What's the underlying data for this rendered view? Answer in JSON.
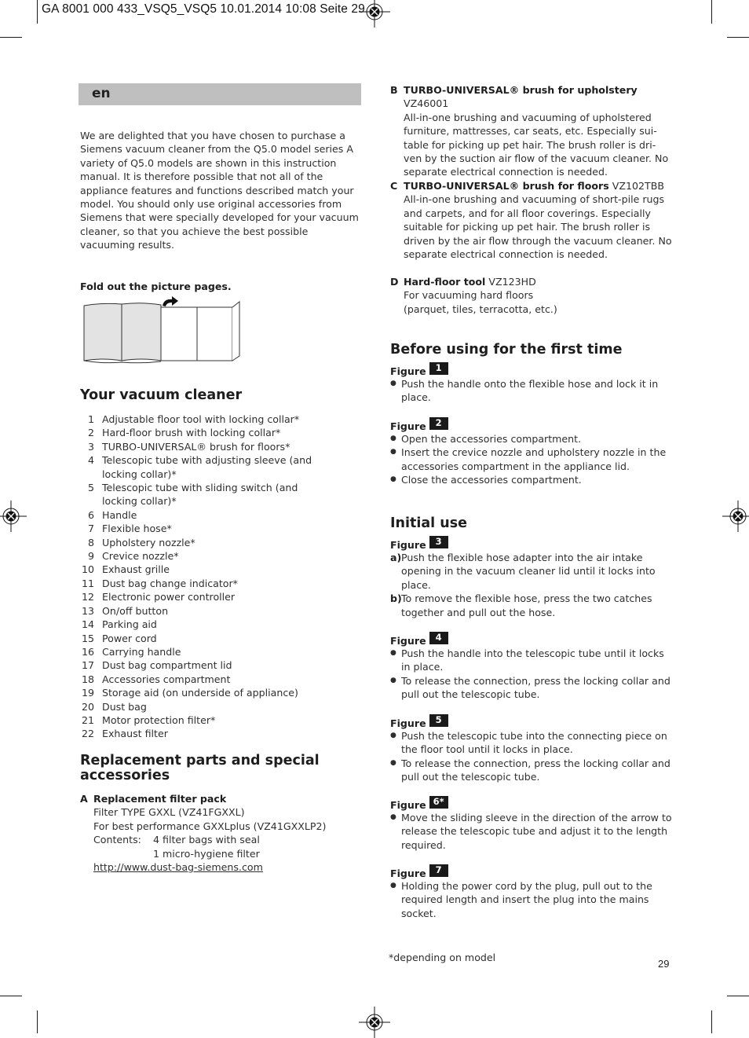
{
  "slug": "GA 8001 000 433_VSQ5_VSQ5  10.01.2014  10:08  Seite 29",
  "language_tab": "en",
  "intro": "We are delighted that you have chosen to purchase a Siemens vacuum cleaner from the Q5.0 model series A variety of Q5.0 models are shown in this instruction manual. It is therefore possible that not all of the appliance features and functions described match your model. You should only use original accessories from Siemens that were specially developed for your vacuum cleaner, so that you achieve the best possible vacuuming results.",
  "fold_out": "Fold out the picture pages.",
  "your_vacuum": {
    "heading": "Your vacuum cleaner",
    "parts": [
      {
        "n": "1",
        "t": "Adjustable floor tool with locking collar*"
      },
      {
        "n": "2",
        "t": "Hard-floor brush with locking collar*"
      },
      {
        "n": "3",
        "t": "TURBO-UNIVERSAL® brush for floors*"
      },
      {
        "n": "4",
        "t": "Telescopic tube with adjusting sleeve (and locking collar)*"
      },
      {
        "n": "5",
        "t": "Telescopic tube with sliding switch (and locking collar)*"
      },
      {
        "n": "6",
        "t": "Handle"
      },
      {
        "n": "7",
        "t": "Flexible hose*"
      },
      {
        "n": "8",
        "t": "Upholstery nozzle*"
      },
      {
        "n": "9",
        "t": "Crevice nozzle*"
      },
      {
        "n": "10",
        "t": "Exhaust grille"
      },
      {
        "n": "11",
        "t": "Dust bag change indicator*"
      },
      {
        "n": "12",
        "t": "Electronic power controller"
      },
      {
        "n": "13",
        "t": "On/off button"
      },
      {
        "n": "14",
        "t": "Parking aid"
      },
      {
        "n": "15",
        "t": "Power cord"
      },
      {
        "n": "16",
        "t": "Carrying handle"
      },
      {
        "n": "17",
        "t": "Dust bag compartment lid"
      },
      {
        "n": "18",
        "t": "Accessories compartment"
      },
      {
        "n": "19",
        "t": "Storage aid (on underside of appliance)"
      },
      {
        "n": "20",
        "t": "Dust bag"
      },
      {
        "n": "21",
        "t": "Motor protection filter*"
      },
      {
        "n": "22",
        "t": "Exhaust filter"
      }
    ]
  },
  "replacement": {
    "heading": "Replacement parts and special accessories",
    "A": {
      "letter": "A",
      "title": "Replacement filter pack",
      "line1": "Filter TYPE GXXL (VZ41FGXXL)",
      "line2": "For best performance GXXLplus (VZ41GXXLP2)",
      "contents_label": "Contents:",
      "contents_1": "4 filter bags with seal",
      "contents_2": "1 micro-hygiene filter",
      "url": "http://www.dust-bag-siemens.com"
    },
    "B": {
      "letter": "B",
      "title": "TURBO-UNIVERSAL® brush for upholstery",
      "code": "VZ46001",
      "body": "All-in-one brushing and vacuuming of upholstered furniture, mattresses, car seats, etc. Especially sui-table for picking up pet hair. The brush roller is dri-ven by the suction air flow of the vacuum cleaner. No separate electrical connection is needed."
    },
    "C": {
      "letter": "C",
      "title": "TURBO-UNIVERSAL® brush for floors",
      "code": "VZ102TBB",
      "body": "All-in-one brushing and vacuuming of short-pile rugs and carpets, and for all floor coverings. Especially suitable for picking up pet hair. The brush roller is driven by the air flow through the vacuum cleaner. No separate electrical connection is needed."
    },
    "D": {
      "letter": "D",
      "title": "Hard-floor tool",
      "code": "VZ123HD",
      "line1": "For vacuuming hard floors",
      "line2": "(parquet, tiles, terracotta, etc.)"
    }
  },
  "before_first": {
    "heading": "Before using for the first time",
    "fig1": {
      "label": "Figure",
      "num": "1",
      "items": [
        "Push the handle onto the flexible hose and lock it in place."
      ]
    },
    "fig2": {
      "label": "Figure",
      "num": "2",
      "items": [
        "Open the accessories compartment.",
        "Insert the crevice nozzle and upholstery nozzle in the accessories compartment in the appliance lid.",
        "Close the accessories compartment."
      ]
    }
  },
  "initial_use": {
    "heading": "Initial use",
    "fig3": {
      "label": "Figure",
      "num": "3",
      "steps": [
        {
          "m": "a)",
          "t": "Push the flexible hose adapter into the air intake opening in the vacuum cleaner lid until it locks into place."
        },
        {
          "m": "b)",
          "t": "To remove the flexible hose, press the two catches together and pull out the hose."
        }
      ]
    },
    "fig4": {
      "label": "Figure",
      "num": "4",
      "items": [
        "Push the handle into the telescopic tube until it locks in place.",
        "To release the connection, press the locking collar and pull out the telescopic tube."
      ]
    },
    "fig5": {
      "label": "Figure",
      "num": "5",
      "items": [
        "Push the telescopic tube into the connecting piece on the floor tool until it locks in place.",
        "To release the connection, press the locking collar and pull out the telescopic tube."
      ]
    },
    "fig6": {
      "label": "Figure",
      "num": "6*",
      "items": [
        "Move the sliding sleeve in the direction of the arrow to release the telescopic tube and adjust it to the length required."
      ]
    },
    "fig7": {
      "label": "Figure",
      "num": "7",
      "items": [
        "Holding the power cord by the plug, pull out to the required length and insert the plug into the mains socket."
      ]
    }
  },
  "footnote": "*depending on model",
  "page_number": "29"
}
